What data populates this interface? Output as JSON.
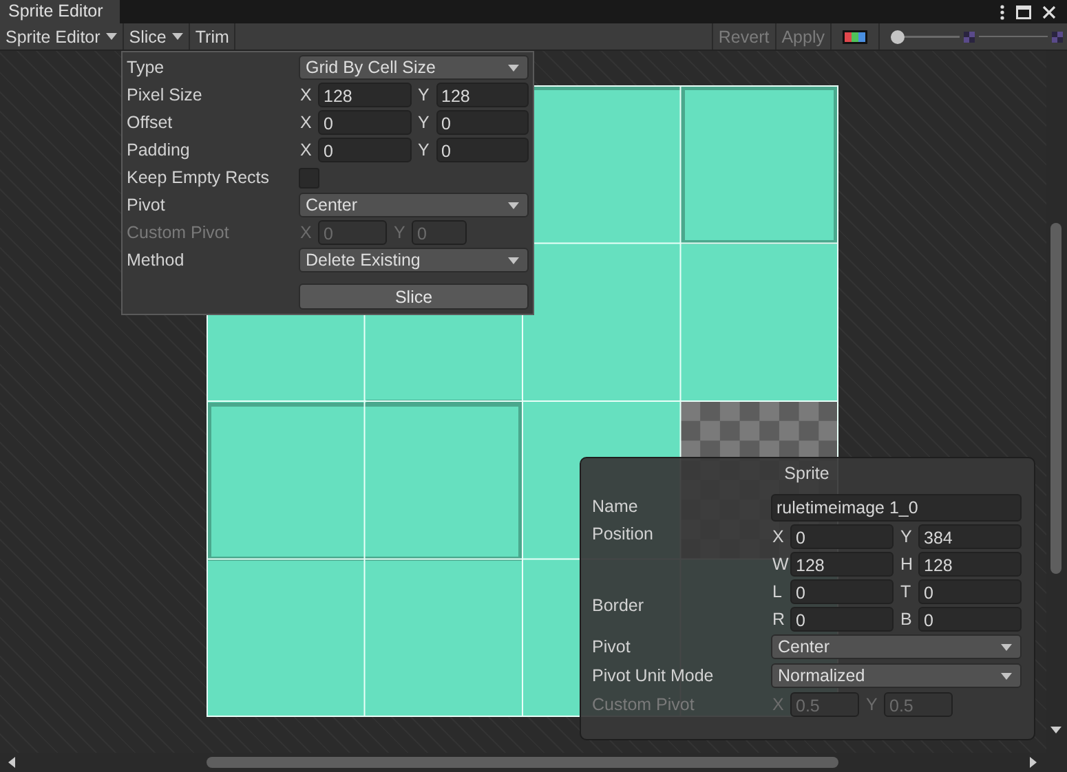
{
  "window": {
    "title": "Sprite Editor"
  },
  "toolbar": {
    "left": [
      {
        "label": "Sprite Editor",
        "dropdown": true
      },
      {
        "label": "Slice",
        "dropdown": true
      },
      {
        "label": "Trim",
        "dropdown": false
      }
    ],
    "right": [
      {
        "label": "Revert",
        "disabled": true
      },
      {
        "label": "Apply",
        "disabled": true
      }
    ],
    "zoom_slider": {
      "level": 0
    }
  },
  "slice": {
    "rows": [
      {
        "kind": "dropdown",
        "label": "Type",
        "value": "Grid By Cell Size"
      },
      {
        "kind": "xy",
        "label": "Pixel Size",
        "fields": [
          {
            "axis": "X",
            "value": "128"
          },
          {
            "axis": "Y",
            "value": "128"
          }
        ]
      },
      {
        "kind": "xy",
        "label": "Offset",
        "fields": [
          {
            "axis": "X",
            "value": "0"
          },
          {
            "axis": "Y",
            "value": "0"
          }
        ]
      },
      {
        "kind": "xy",
        "label": "Padding",
        "fields": [
          {
            "axis": "X",
            "value": "0"
          },
          {
            "axis": "Y",
            "value": "0"
          }
        ]
      },
      {
        "kind": "checkbox",
        "label": "Keep Empty Rects",
        "checked": false
      },
      {
        "kind": "dropdown",
        "label": "Pivot",
        "value": "Center"
      },
      {
        "kind": "xy",
        "label": "Custom Pivot",
        "disabled": true,
        "fields": [
          {
            "axis": "X",
            "value": "0"
          },
          {
            "axis": "Y",
            "value": "0"
          }
        ]
      },
      {
        "kind": "dropdown",
        "label": "Method",
        "value": "Delete Existing"
      }
    ],
    "button": "Slice"
  },
  "sprite_panel": {
    "title": "Sprite",
    "rows": [
      {
        "kind": "text",
        "label": "Name",
        "value": "ruletimeimage 1_0"
      },
      {
        "kind": "grid",
        "label": "Position",
        "lines": [
          [
            {
              "axis": "X",
              "value": "0"
            },
            {
              "axis": "Y",
              "value": "384"
            }
          ],
          [
            {
              "axis": "W",
              "value": "128"
            },
            {
              "axis": "H",
              "value": "128"
            }
          ]
        ]
      },
      {
        "kind": "grid",
        "label": "Border",
        "lines": [
          [
            {
              "axis": "L",
              "value": "0"
            },
            {
              "axis": "T",
              "value": "0"
            }
          ],
          [
            {
              "axis": "R",
              "value": "0"
            },
            {
              "axis": "B",
              "value": "0"
            }
          ]
        ]
      },
      {
        "kind": "dropdown",
        "label": "Pivot",
        "value": "Center"
      },
      {
        "kind": "dropdown",
        "label": "Pivot Unit Mode",
        "value": "Normalized"
      },
      {
        "kind": "xy",
        "label": "Custom Pivot",
        "disabled": true,
        "fields": [
          {
            "axis": "X",
            "value": "0.5"
          },
          {
            "axis": "Y",
            "value": "0.5"
          }
        ]
      }
    ]
  }
}
